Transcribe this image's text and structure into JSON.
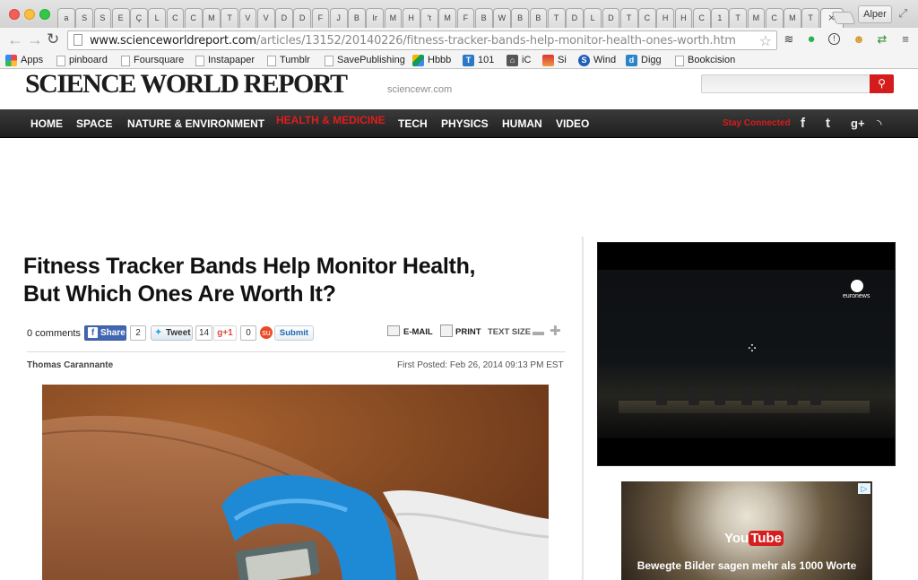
{
  "browser": {
    "tab_initials": [
      "a",
      "S",
      "S",
      "E",
      "Ç",
      "L",
      "C",
      "C",
      "M",
      "T",
      "V",
      "V",
      "D",
      "D",
      "F",
      "J",
      "B",
      "Ir",
      "M",
      "H",
      "'t",
      "M",
      "F",
      "B",
      "W",
      "B",
      "B",
      "T",
      "D",
      "L",
      "D",
      "T",
      "C",
      "H",
      "H",
      "C",
      "1",
      "T",
      "M",
      "C",
      "M",
      "T"
    ],
    "active_tab_close": "×",
    "profile_name": "Alper",
    "url_host": "www.scienceworldreport.com",
    "url_path": "/articles/13152/20140226/fitness-tracker-bands-help-monitor-health-ones-worth.htm",
    "bookmarks": [
      "Apps",
      "pinboard",
      "Foursquare",
      "Instapaper",
      "Tumblr",
      "SavePublishing",
      "Hbbb",
      "101",
      "iC",
      "Si",
      "Wind",
      "Digg",
      "Bookcision"
    ]
  },
  "site": {
    "logo": "SCIENCE WORLD REPORT",
    "logo_sub": "sciencewr.com",
    "nav": [
      "HOME",
      "SPACE",
      "NATURE & ENVIRONMENT",
      "HEALTH & MEDICINE",
      "TECH",
      "PHYSICS",
      "HUMAN",
      "VIDEO"
    ],
    "active_nav": "HEALTH & MEDICINE",
    "stay_connected": "Stay Connected",
    "accent_color": "#d51c1c"
  },
  "article": {
    "title_line1": "Fitness Tracker Bands Help Monitor Health,",
    "title_line2": "But Which Ones Are Worth It?",
    "comments": "0 comments",
    "share": {
      "facebook_label": "Share",
      "facebook_count": "2",
      "tweet_label": "Tweet",
      "tweet_count": "14",
      "gplus_label": "g+1",
      "gplus_count": "0",
      "submit_label": "Submit"
    },
    "tools": {
      "email": "E-MAIL",
      "print": "PRINT",
      "text_size": "TEXT SIZE"
    },
    "author": "Thomas Carannante",
    "posted": "First Posted: Feb 26, 2014 09:13 PM EST"
  },
  "sidebar": {
    "video_brand": "euronews",
    "ad_logo_you": "You",
    "ad_logo_tube": "Tube",
    "ad_text": "Bewegte Bilder sagen mehr als 1000 Worte"
  }
}
